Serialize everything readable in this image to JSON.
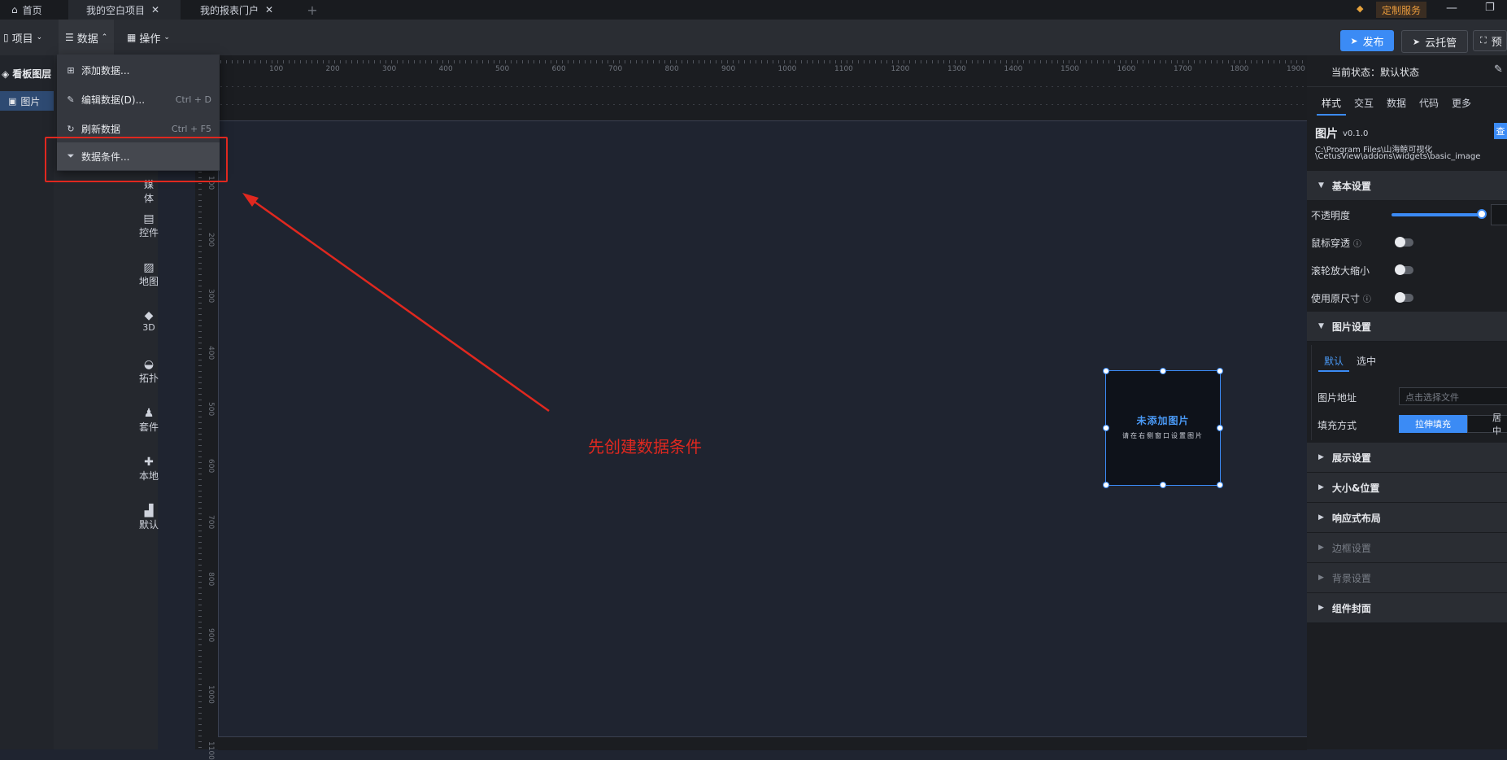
{
  "titlebar": {
    "tabs": [
      {
        "label": "首页",
        "active": false
      },
      {
        "label": "我的空白项目",
        "active": true
      },
      {
        "label": "我的报表门户",
        "active": false
      }
    ],
    "custom_service": "定制服务"
  },
  "toolbar": {
    "project": "项目",
    "data": "数据",
    "operate": "操作",
    "publish": "发布",
    "cloud": "云托管",
    "preview": "预"
  },
  "menu": {
    "items": [
      {
        "label": "添加数据...",
        "shortcut": ""
      },
      {
        "label": "编辑数据(D)...",
        "shortcut": "Ctrl + D"
      },
      {
        "label": "刷新数据",
        "shortcut": "Ctrl + F5"
      },
      {
        "label": "数据条件...",
        "shortcut": ""
      }
    ]
  },
  "layers": {
    "title": "看板图层",
    "item": "图片"
  },
  "components": [
    "媒体",
    "控件",
    "地图",
    "3D",
    "拓扑",
    "套件",
    "本地",
    "默认"
  ],
  "ruler": {
    "top": [
      "100",
      "200",
      "300",
      "400",
      "500",
      "600",
      "700",
      "800",
      "900",
      "1000",
      "1100",
      "1200",
      "1300",
      "1400",
      "1500",
      "1600",
      "1700",
      "1800",
      "1900"
    ],
    "left": [
      "100",
      "200",
      "300",
      "400",
      "500",
      "600",
      "700",
      "800",
      "900",
      "1000",
      "1100"
    ]
  },
  "canvas": {
    "widget_title": "未添加图片",
    "widget_sub": "请在右侧窗口设置图片",
    "annotation": "先创建数据条件"
  },
  "rpanel": {
    "state": "当前状态：默认状态",
    "tabs": [
      "样式",
      "交互",
      "数据",
      "代码",
      "更多"
    ],
    "widget_name": "图片",
    "version": "v0.1.0",
    "path1": "C:\\Program Files\\山海鲸可视化",
    "path2": "\\CetusView\\addons\\widgets\\basic_image",
    "view_btn": "查",
    "basic": "基本设置",
    "opacity": "不透明度",
    "mouse_through": "鼠标穿透",
    "wheel_zoom": "滚轮放大缩小",
    "original_size": "使用原尺寸",
    "image_settings": "图片设置",
    "img_tabs": [
      "默认",
      "选中"
    ],
    "img_addr": "图片地址",
    "img_placeholder": "点击选择文件",
    "fill_mode": "填充方式",
    "fill_stretch": "拉伸填充",
    "fill_center": "居中",
    "sections": [
      "展示设置",
      "大小&位置",
      "响应式布局",
      "边框设置",
      "背景设置",
      "组件封面"
    ]
  },
  "colors": {
    "accent": "#3b8bf5",
    "annotation": "#e0281f"
  }
}
